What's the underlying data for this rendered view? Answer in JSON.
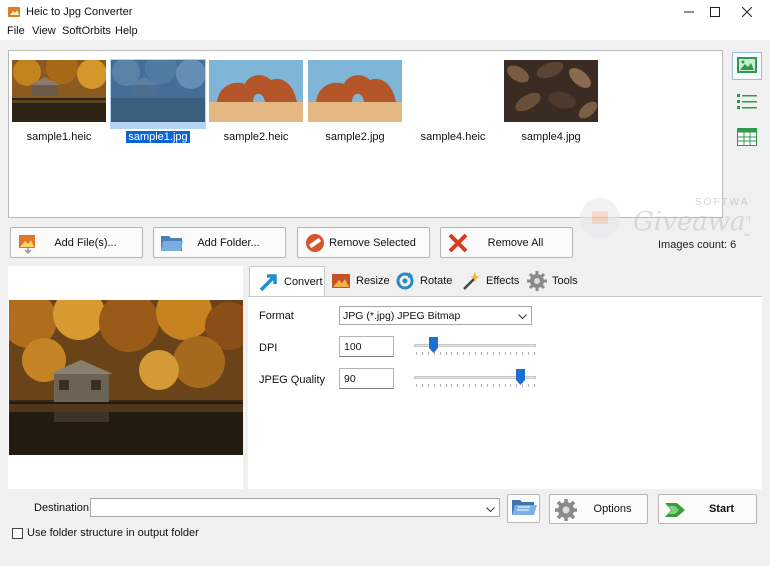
{
  "window": {
    "title": "Heic to Jpg Converter",
    "minimize_icon": "minimize-icon",
    "maximize_icon": "maximize-icon",
    "close_icon": "close-icon"
  },
  "menu": [
    "File",
    "View",
    "SoftOrbits",
    "Help"
  ],
  "thumbnails": [
    {
      "caption": "sample1.heic",
      "selected": false,
      "image": "autumn-lake-cabin"
    },
    {
      "caption": "sample1.jpg",
      "selected": true,
      "image": "autumn-lake-cabin"
    },
    {
      "caption": "sample2.heic",
      "selected": false,
      "image": "desert-rock-arch"
    },
    {
      "caption": "sample2.jpg",
      "selected": false,
      "image": "desert-rock-arch"
    },
    {
      "caption": "sample4.heic",
      "selected": false,
      "image": "blank"
    },
    {
      "caption": "sample4.jpg",
      "selected": false,
      "image": "dry-leaves"
    }
  ],
  "view_buttons": [
    "thumbnail-view-icon",
    "list-view-icon",
    "table-view-icon"
  ],
  "actions": {
    "add_files": "Add File(s)...",
    "add_folder": "Add Folder...",
    "remove_selected": "Remove Selected",
    "remove_all": "Remove All"
  },
  "images_count": "Images count: 6",
  "watermark": {
    "top": "SOFTWARE",
    "main": "Giveaway"
  },
  "tabs": [
    {
      "label": "Convert",
      "icon": "convert-arrow-icon",
      "active": true
    },
    {
      "label": "Resize",
      "icon": "resize-photo-icon",
      "active": false
    },
    {
      "label": "Rotate",
      "icon": "rotate-icon",
      "active": false
    },
    {
      "label": "Effects",
      "icon": "magic-wand-icon",
      "active": false
    },
    {
      "label": "Tools",
      "icon": "gear-icon",
      "active": false
    }
  ],
  "convert": {
    "format_label": "Format",
    "format_value": "JPG (*.jpg) JPEG Bitmap",
    "dpi_label": "DPI",
    "dpi_value": "100",
    "dpi_slider_fraction": 0.13,
    "quality_label": "JPEG Quality",
    "quality_value": "90",
    "quality_slider_fraction": 0.9
  },
  "bottom": {
    "destination_label": "Destination",
    "destination_value": "",
    "options_label": "Options",
    "start_label": "Start",
    "folder_structure_label": "Use folder structure in output folder",
    "folder_structure_checked": false
  },
  "colors": {
    "selection_blue": "#0a64d6",
    "selection_bg": "#b5d3f3",
    "start_green": "#3a9d3a"
  }
}
